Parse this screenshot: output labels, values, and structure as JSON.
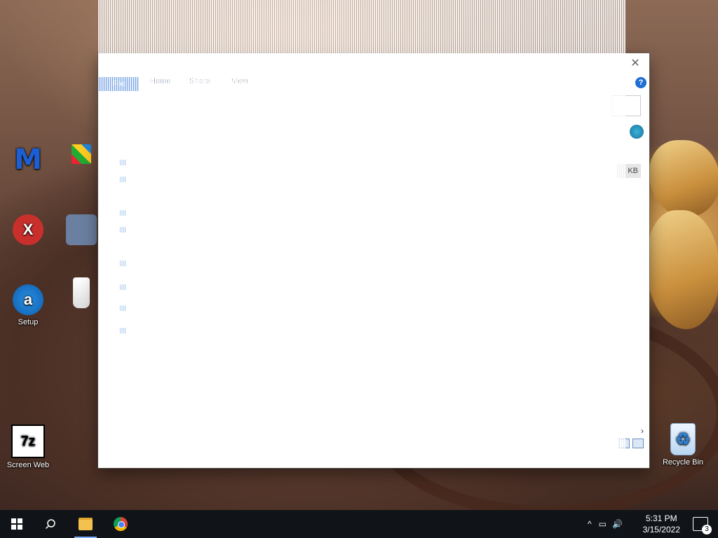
{
  "desktop": {
    "icons": [
      {
        "label": "",
        "icon": "malwarebytes-icon"
      },
      {
        "label": "",
        "icon": "app-grid-icon"
      },
      {
        "label": "",
        "icon": "xbox-icon"
      },
      {
        "label": "",
        "icon": "usb-icon"
      },
      {
        "label": "Setup",
        "icon": "setup-icon"
      },
      {
        "label": "",
        "icon": "bottle-icon"
      },
      {
        "label": "Screen Web",
        "icon": "sevenzip-icon"
      },
      {
        "label": "Recycle Bin",
        "icon": "recycle-bin-icon"
      }
    ]
  },
  "explorer": {
    "close_glyph": "✕",
    "help_glyph": "?",
    "ribbon_tabs": [
      "File",
      "Home",
      "Share",
      "View"
    ],
    "size_unit": "KB",
    "scroll_right_glyph": "›"
  },
  "taskbar": {
    "clock_time": "5:31 PM",
    "clock_date": "3/15/2022",
    "notification_count": "3",
    "tray_chevron": "^",
    "tray_network": "▭",
    "tray_volume": "🔊"
  }
}
